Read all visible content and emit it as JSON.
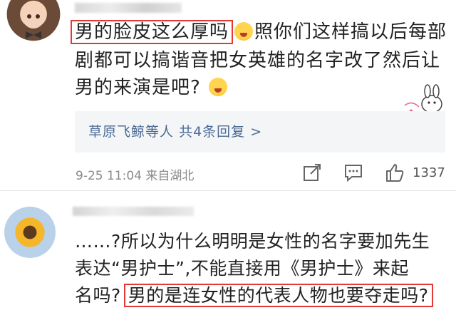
{
  "comment1": {
    "highlight": "男的脸皮这么厚吗",
    "line1_rest": "照你们这样搞以后每部",
    "line2": "剧都可以搞谐音把女英雄的名字改了然后让",
    "line3": "男的来演是吧?",
    "emoji": "scream-emoji",
    "replies_user": "草原飞鲸等人",
    "replies_count": "共4条回复 >",
    "date": "9-25 11:04",
    "location": "来自湖北",
    "likes": "1337"
  },
  "comment2": {
    "line1": "……?所以为什么明明是女性的名字要加先生",
    "line2": "表达“男护士”,不能直接用《男护士》来起",
    "line3_plain": "名吗?",
    "highlight": "男的是连女性的代表人物也要夺走吗?"
  },
  "colors": {
    "highlight_border": "#e53935",
    "link": "#4a6b95",
    "meta": "#8a8a8a"
  }
}
